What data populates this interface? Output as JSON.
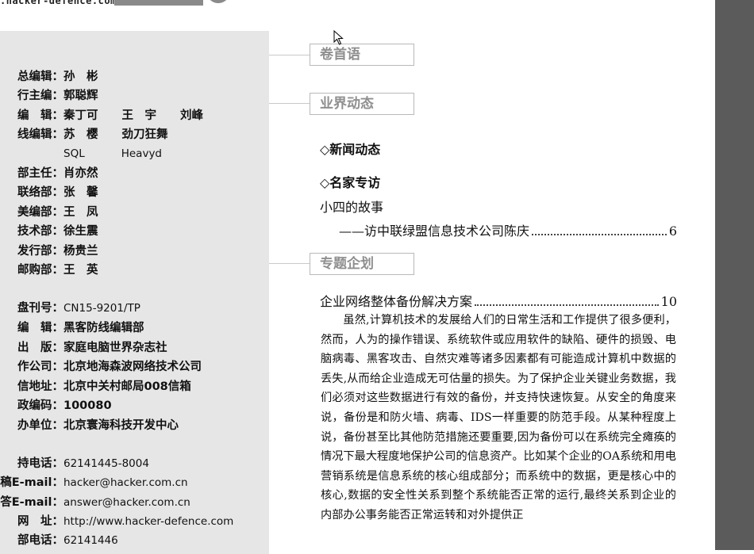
{
  "header": {
    "site_url": ".hacker-defence.com"
  },
  "masthead": {
    "rows": [
      {
        "label": "总编辑：",
        "value": "孙　彬"
      },
      {
        "label": "行主编：",
        "value": "郭聪辉"
      },
      {
        "label": "编　辑：",
        "value": "秦丁可",
        "value2": "王　宇",
        "value3": "刘峰"
      },
      {
        "label": "线编辑：",
        "value": "苏　樱",
        "value2": "劲刀狂舞"
      },
      {
        "label": "",
        "value": "SQL",
        "value2": "Heavyd"
      },
      {
        "label": "部主任：",
        "value": "肖亦然"
      },
      {
        "label": "联络部：",
        "value": "张　馨"
      },
      {
        "label": "美编部：",
        "value": "王　凤"
      },
      {
        "label": "技术部：",
        "value": "徐生震"
      },
      {
        "label": "发行部：",
        "value": "杨贵兰"
      },
      {
        "label": "邮购部：",
        "value": "王　英"
      },
      {
        "label": "盘刊号：",
        "value": "CN15-9201/TP"
      },
      {
        "label": "编　辑：",
        "value": "黑客防线编辑部"
      },
      {
        "label": "出　版：",
        "value": "家庭电脑世界杂志社"
      },
      {
        "label": "作公司：",
        "value": "北京地海森波网络技术公司"
      },
      {
        "label": "信地址：",
        "value": "北京中关村邮局008信箱"
      },
      {
        "label": "政编码：",
        "value": "100080"
      },
      {
        "label": "办单位：",
        "value": "北京寰海科技开发中心"
      },
      {
        "label": "持电话：",
        "value": "62141445-8004"
      },
      {
        "label": "稿E-mail：",
        "value": "hacker@hacker.com.cn"
      },
      {
        "label": "答E-mail：",
        "value": "answer@hacker.com.cn"
      },
      {
        "label": "网　址：",
        "value": "http://www.hacker-defence.com"
      },
      {
        "label": "部电话：",
        "value": "62141446"
      }
    ]
  },
  "toc": {
    "section1": "卷首语",
    "section2": "业界动态",
    "news_head": "◇新闻动态",
    "interview_head": "◇名家专访",
    "story_title": "小四的故事",
    "story_sub": "——访中联绿盟信息技术公司陈庆",
    "story_page": "6",
    "section3": "专题企划",
    "feature_title": "企业网络整体备份解决方案",
    "feature_page": "10",
    "feature_body": "虽然,计算机技术的发展给人们的日常生活和工作提供了很多便利，然而，人为的操作错误、系统软件或应用软件的缺陷、硬件的损毁、电脑病毒、黑客攻击、自然灾难等诸多因素都有可能造成计算机中数据的丢失,从而给企业造成无可估量的损失。为了保护企业关键业务数据，我们必须对这些数据进行有效的备份，并支持快速恢复。从安全的角度来说，备份是和防火墙、病毒、IDS一样重要的防范手段。从某种程度上说，备份甚至比其他防范措施还要重要,因为备份可以在系统完全瘫痪的情况下最大程度地保护公司的信息资产。比如某个企业的OA系统和用电营销系统是信息系统的核心组成部分；而系统中的数据，更是核心中的核心,数据的安全性关系到整个系统能否正常的运行,最终关系到企业的内部办公事务能否正常运转和对外提供正"
  }
}
